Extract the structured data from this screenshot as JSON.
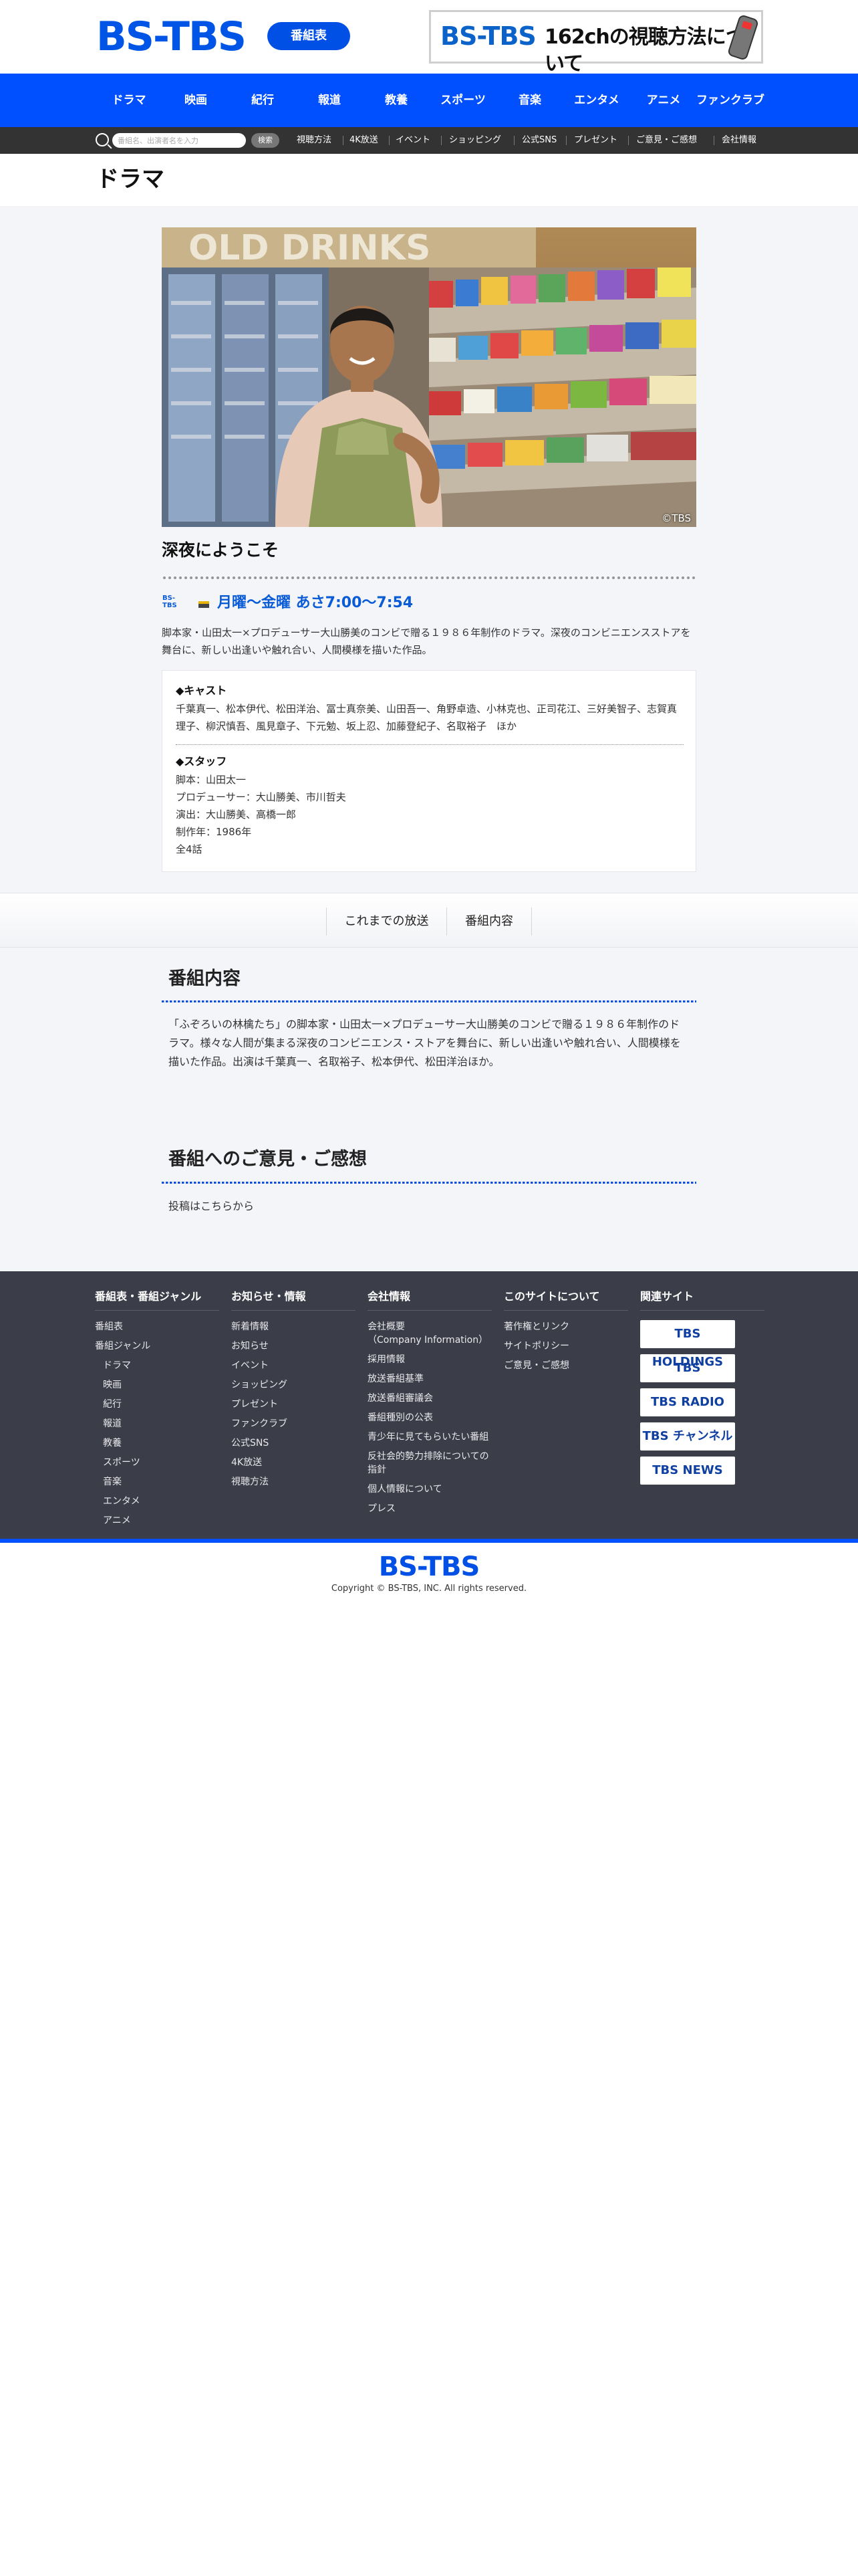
{
  "header": {
    "logo": "BS-TBS",
    "program_guide_label": "番組表",
    "banner": {
      "logo": "BS-TBS",
      "text": "162chの視聴方法について"
    }
  },
  "main_nav": [
    "ドラマ",
    "映画",
    "紀行",
    "報道",
    "教養",
    "スポーツ",
    "音楽",
    "エンタメ",
    "アニメ",
    "ファンクラブ"
  ],
  "sub_nav": {
    "search_placeholder": "番組名、出演者名を入力",
    "search_button": "検索",
    "links": [
      "視聴方法",
      "4K放送",
      "イベント",
      "ショッピング",
      "公式SNS",
      "プレゼント",
      "ご意見・ご感想",
      "会社情報"
    ]
  },
  "page_title": "ドラマ",
  "hero": {
    "credit": "©TBS"
  },
  "show": {
    "title": "深夜にようこそ",
    "channel_logo": "BS-TBS",
    "schedule": "月曜～金曜 あさ7:00～7:54",
    "summary": "脚本家・山田太一×プロデューサー大山勝美のコンビで贈る１９８６年制作のドラマ。深夜のコンビニエンスストアを舞台に、新しい出逢いや触れ合い、人間模様を描いた作品。"
  },
  "info": {
    "cast_heading": "◆キャスト",
    "cast": "千葉真一、松本伊代、松田洋治、冨士真奈美、山田吾一、角野卓造、小林克也、正司花江、三好美智子、志賀真理子、柳沢慎吾、風見章子、下元勉、坂上忍、加藤登紀子、名取裕子　ほか",
    "staff_heading": "◆スタッフ",
    "staff": [
      "脚本：山田太一",
      "プロデューサー：大山勝美、市川哲夫",
      "演出：大山勝美、高橋一郎",
      "制作年：1986年",
      "全4話"
    ]
  },
  "tabs": [
    "これまでの放送",
    "番組内容"
  ],
  "program_section": {
    "title": "番組内容",
    "text": "「ふぞろいの林檎たち」の脚本家・山田太一×プロデューサー大山勝美のコンビで贈る１９８６年制作のドラマ。様々な人間が集まる深夜のコンビニエンス・ストアを舞台に、新しい出逢いや触れ合い、人間模様を描いた作品。出演は千葉真一、名取裕子、松本伊代、松田洋治ほか。"
  },
  "feedback_section": {
    "title": "番組へのご意見・ご感想",
    "text": "投稿はこちらから"
  },
  "footer": {
    "columns": [
      {
        "title": "番組表・番組ジャンル",
        "links": [
          "番組表",
          "番組ジャンル"
        ],
        "sub_links": [
          "ドラマ",
          "映画",
          "紀行",
          "報道",
          "教養",
          "スポーツ",
          "音楽",
          "エンタメ",
          "アニメ"
        ]
      },
      {
        "title": "お知らせ・情報",
        "links": [
          "新着情報",
          "お知らせ",
          "イベント",
          "ショッピング",
          "プレゼント",
          "ファンクラブ",
          "公式SNS",
          "4K放送",
          "視聴方法"
        ]
      },
      {
        "title": "会社情報",
        "links": [
          "会社概要\n（Company Information）",
          "採用情報",
          "放送番組基準",
          "放送番組審議会",
          "番組種別の公表",
          "青少年に見てもらいたい番組",
          "反社会的勢力排除についての指針",
          "個人情報について",
          "プレス"
        ]
      },
      {
        "title": "このサイトについて",
        "links": [
          "著作権とリンク",
          "サイトポリシー",
          "ご意見・ご感想"
        ]
      },
      {
        "title": "関連サイト",
        "links": [
          "TBS HOLDINGS",
          "TBS",
          "TBS RADIO",
          "TBS チャンネル",
          "TBS NEWS"
        ]
      }
    ],
    "logo": "BS-TBS",
    "copyright": "Copyright © BS-TBS, INC. All rights reserved."
  },
  "colors": {
    "brand_blue": "#0050ff",
    "footer_bg": "#3b3d48",
    "content_bg": "#f4f5f9"
  }
}
